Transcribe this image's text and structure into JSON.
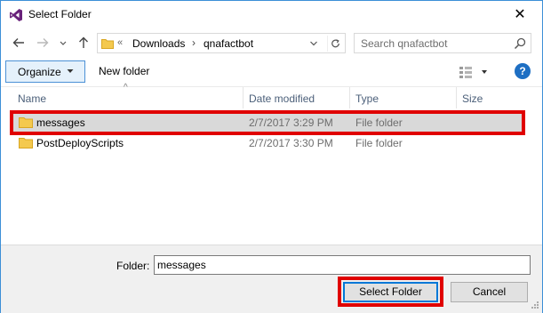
{
  "window": {
    "title": "Select Folder",
    "close_glyph": "✕"
  },
  "nav": {
    "back_icon": "back-arrow-icon",
    "forward_icon": "forward-arrow-icon",
    "recent_icon": "chevron-down-icon",
    "up_icon": "up-arrow-icon",
    "address": {
      "overflow": "«",
      "crumbs": [
        "Downloads",
        "qnafactbot"
      ],
      "separator": "›"
    },
    "search_placeholder": "Search qnafactbot"
  },
  "toolbar": {
    "organize_label": "Organize",
    "new_folder_label": "New folder",
    "help_label": "?"
  },
  "list": {
    "columns": [
      "Name",
      "Date modified",
      "Type",
      "Size"
    ],
    "sort_indicator": "^",
    "rows": [
      {
        "name": "messages",
        "date": "2/7/2017 3:29 PM",
        "type": "File folder",
        "selected": true
      },
      {
        "name": "PostDeployScripts",
        "date": "2/7/2017 3:30 PM",
        "type": "File folder",
        "selected": false
      }
    ]
  },
  "footer": {
    "folder_label": "Folder:",
    "folder_value": "messages",
    "select_button": "Select Folder",
    "cancel_button": "Cancel"
  },
  "colors": {
    "highlight": "#e00000",
    "accent": "#0078d7",
    "folder": "#f4c94e"
  }
}
